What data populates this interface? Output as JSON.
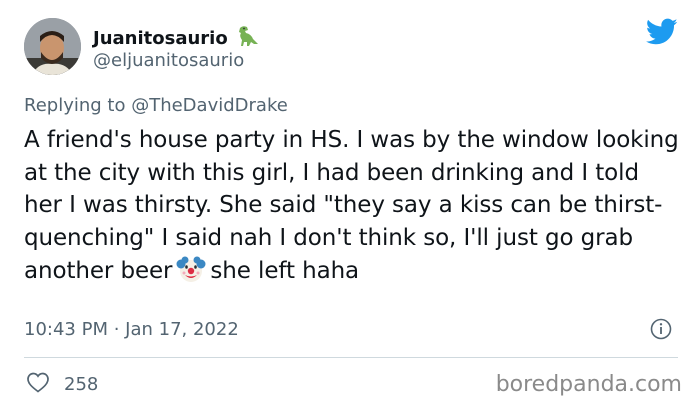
{
  "author": {
    "display_name": "Juanitosaurio",
    "handle": "@eljuanitosaurio",
    "name_emoji_icon": "t-rex-dinosaur-icon"
  },
  "reply": {
    "prefix": "Replying to ",
    "mention": "@TheDavidDrake"
  },
  "tweet": {
    "text_part1": "A friend's house party in HS. I was by the window looking at the city with this girl, I had been drinking and I told her I was thirsty. She said \"they say a kiss can be thirst-quenching\" I said nah I don't think so, I'll just go grab another beer",
    "inline_emoji_icon": "clown-face-icon",
    "text_part2": "she left haha",
    "timestamp": "10:43 PM · Jan 17, 2022"
  },
  "stats": {
    "likes": "258"
  },
  "watermark": "boredpanda.com",
  "colors": {
    "twitter_blue": "#1d9bf0",
    "secondary_text": "#536471",
    "primary_text": "#0f1419",
    "divider": "#cfd9de"
  }
}
